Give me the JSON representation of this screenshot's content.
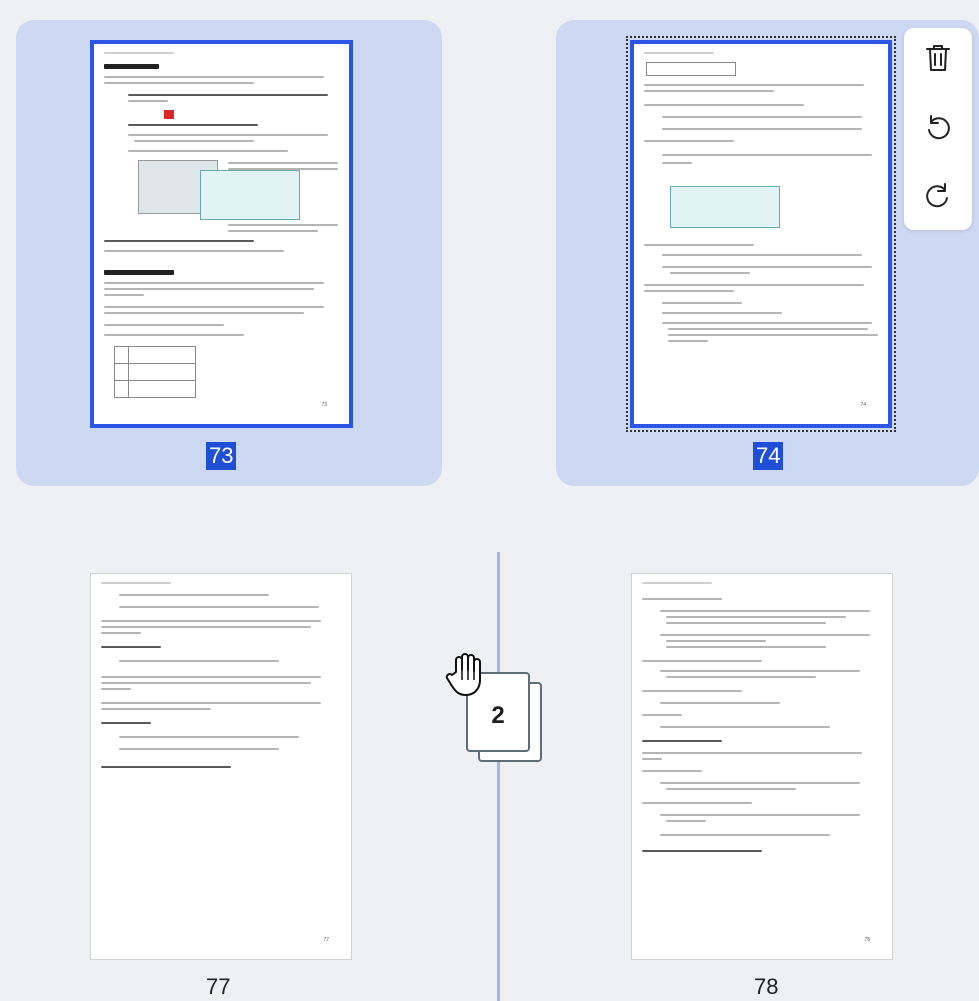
{
  "pages": [
    {
      "number": "73",
      "selected": true
    },
    {
      "number": "74",
      "selected": true
    },
    {
      "number": "77",
      "selected": false
    },
    {
      "number": "78",
      "selected": false
    }
  ],
  "toolbar": {
    "delete_icon": "trash-icon",
    "rotate_ccw_icon": "rotate-counterclockwise-icon",
    "rotate_cw_icon": "rotate-clockwise-icon"
  },
  "drag": {
    "count": "2",
    "cursor_icon": "grab-hand-icon"
  },
  "colors": {
    "selection_card": "#cdd9f3",
    "selection_frame": "#2a55e5",
    "selected_label_bg": "#1f4fd6",
    "drop_indicator": "#9fb7ec"
  }
}
